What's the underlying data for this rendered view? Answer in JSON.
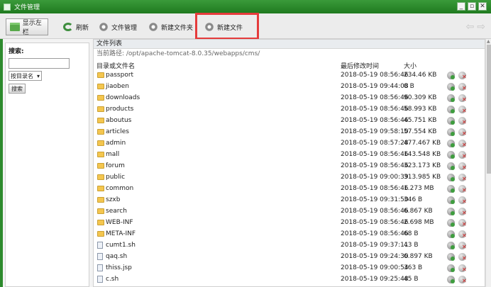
{
  "window": {
    "title": "文件管理"
  },
  "window_buttons": [
    "_",
    "▫",
    "✕"
  ],
  "toolbar": {
    "show_left": "显示左栏",
    "refresh": "刷新",
    "file_manage": "文件管理",
    "new_folder": "新建文件夹",
    "new_file": "新建文件"
  },
  "nav_icons": {
    "back": "⇦",
    "forward": "⇨"
  },
  "left": {
    "search_label": "搜索:",
    "search_value": "",
    "select_value": "按目录名",
    "search_button": "搜索"
  },
  "main": {
    "header": "文件列表",
    "path": "当前路径: /opt/apache-tomcat-8.0.35/webapps/cms/",
    "col_name": "目录或文件名",
    "col_time": "最后修改时间",
    "col_size": "大小",
    "files": [
      {
        "name": "passport",
        "time": "2018-05-19 08:56:46",
        "size": "234.46 KB",
        "type": "folder"
      },
      {
        "name": "jiaoben",
        "time": "2018-05-19 09:44:08",
        "size": "0 B",
        "type": "folder"
      },
      {
        "name": "downloads",
        "time": "2018-05-19 08:56:46",
        "size": "90.309 KB",
        "type": "folder"
      },
      {
        "name": "products",
        "time": "2018-05-19 08:56:46",
        "size": "58.993 KB",
        "type": "folder"
      },
      {
        "name": "aboutus",
        "time": "2018-05-19 08:56:46",
        "size": "45.751 KB",
        "type": "folder"
      },
      {
        "name": "articles",
        "time": "2018-05-19 09:58:10",
        "size": "57.554 KB",
        "type": "folder"
      },
      {
        "name": "admin",
        "time": "2018-05-19 08:57:28",
        "size": "477.467 KB",
        "type": "folder"
      },
      {
        "name": "mall",
        "time": "2018-05-19 08:56:46",
        "size": "143.548 KB",
        "type": "folder"
      },
      {
        "name": "forum",
        "time": "2018-05-19 08:56:46",
        "size": "323.173 KB",
        "type": "folder"
      },
      {
        "name": "public",
        "time": "2018-05-19 09:00:39",
        "size": "313.985 KB",
        "type": "folder"
      },
      {
        "name": "common",
        "time": "2018-05-19 08:56:46",
        "size": "1.273 MB",
        "type": "folder"
      },
      {
        "name": "szxb",
        "time": "2018-05-19 09:31:50",
        "size": "346 B",
        "type": "folder"
      },
      {
        "name": "search",
        "time": "2018-05-19 08:56:46",
        "size": "6.867 KB",
        "type": "folder"
      },
      {
        "name": "WEB-INF",
        "time": "2018-05-19 08:56:46",
        "size": "2.698 MB",
        "type": "folder"
      },
      {
        "name": "META-INF",
        "time": "2018-05-19 08:56:46",
        "size": "68 B",
        "type": "folder"
      },
      {
        "name": "cumt1.sh",
        "time": "2018-05-19 09:37:11",
        "size": "43 B",
        "type": "file"
      },
      {
        "name": "qaq.sh",
        "time": "2018-05-19 09:24:30",
        "size": "6.897 KB",
        "type": "file"
      },
      {
        "name": "thiss.jsp",
        "time": "2018-05-19 09:00:54",
        "size": "363 B",
        "type": "file"
      },
      {
        "name": "c.sh",
        "time": "2018-05-19 09:25:48",
        "size": "45 B",
        "type": "file"
      }
    ]
  },
  "colors": {
    "titlebar": "#1f7a1f",
    "highlight": "#e53b3b",
    "folder": "#f4c64f"
  }
}
